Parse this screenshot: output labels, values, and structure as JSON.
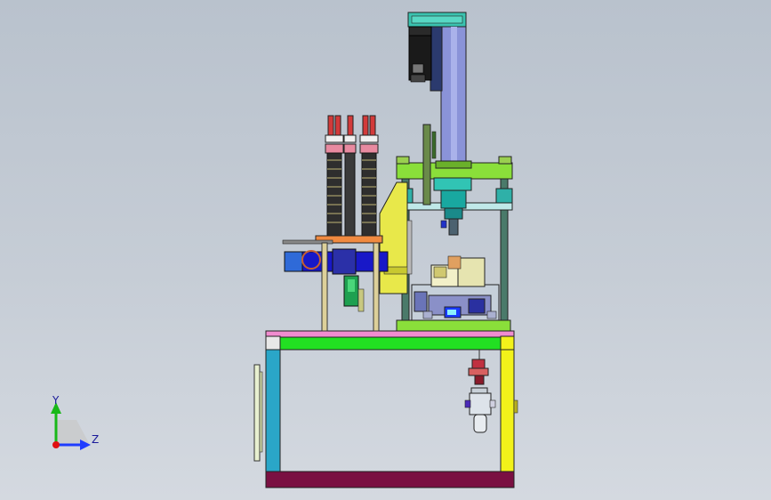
{
  "view": {
    "type": "3D CAD model viewport",
    "background": [
      "#b9c2cd",
      "#d4d9e0"
    ]
  },
  "triad": {
    "y_label": "Y",
    "z_label": "Z",
    "colors": {
      "y": "#18b818",
      "z": "#1f3cff",
      "origin": "#e01010"
    }
  },
  "model_colors": {
    "frame_top": "#22e022",
    "frame_leg_right": "#f2f21a",
    "frame_leg_left": "#2aa6c8",
    "frame_base": "#7a1042",
    "top_plate_strip": "#ff66cc",
    "column": "#7c86d0",
    "motor": "#1a1a1a",
    "press_plates": "#8adf3a",
    "bracket": "#e8e84a",
    "rods": "#d9c98a",
    "spring_tops": "#e23b3b"
  }
}
